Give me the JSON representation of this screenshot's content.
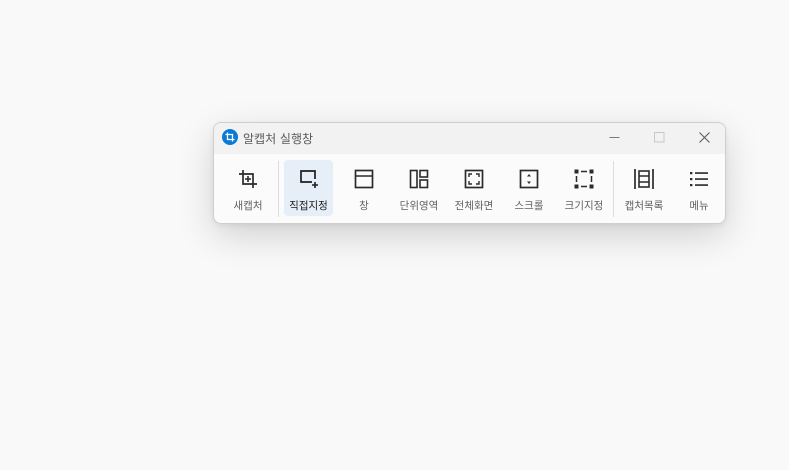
{
  "window": {
    "title": "알캡처 실행창"
  },
  "toolbar": {
    "items": [
      {
        "label": "새캡처",
        "icon": "crop-icon"
      },
      {
        "label": "직접지정",
        "icon": "select-area-icon",
        "active": true
      },
      {
        "label": "창",
        "icon": "window-icon"
      },
      {
        "label": "단위영역",
        "icon": "unit-area-icon"
      },
      {
        "label": "전체화면",
        "icon": "fullscreen-icon"
      },
      {
        "label": "스크롤",
        "icon": "scroll-icon"
      },
      {
        "label": "크기지정",
        "icon": "fixed-size-icon"
      },
      {
        "label": "캡처목록",
        "icon": "capture-list-icon"
      },
      {
        "label": "메뉴",
        "icon": "menu-icon"
      }
    ]
  },
  "colors": {
    "accent": "#0a7ad6",
    "active_bg": "#e6eff8"
  }
}
